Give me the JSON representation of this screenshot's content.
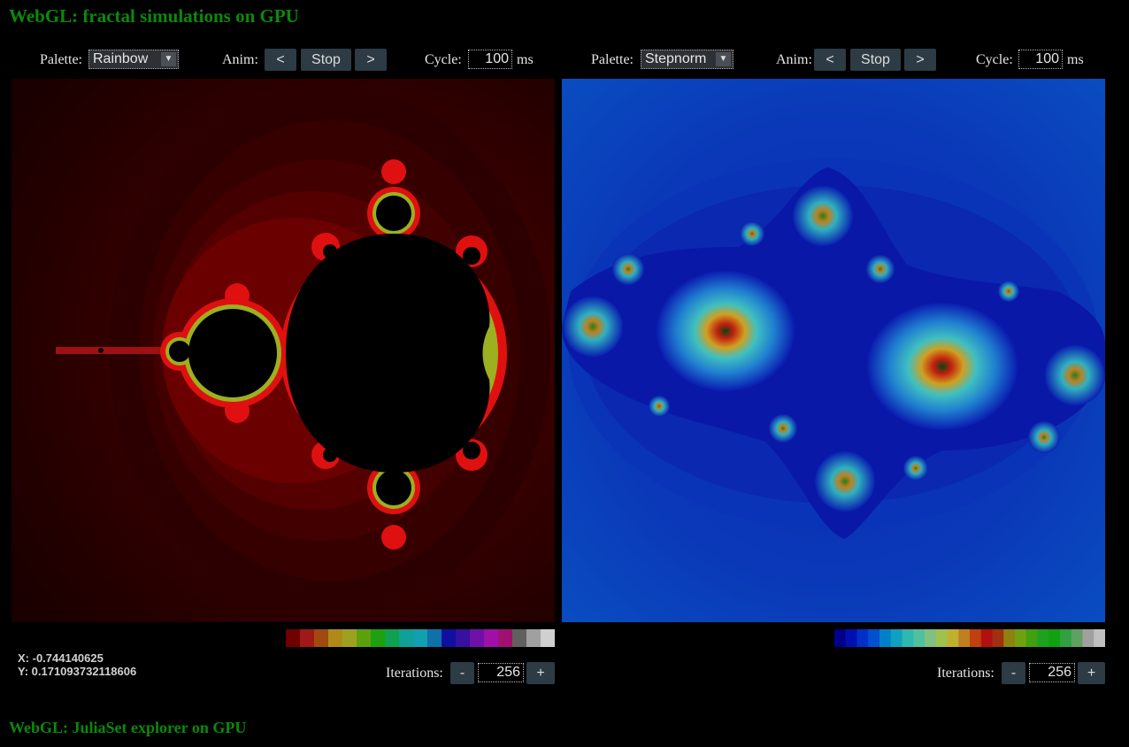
{
  "page_title": "WebGL: fractal simulations on GPU",
  "footer_title": "WebGL: JuliaSet explorer on GPU",
  "left": {
    "palette_label": "Palette:",
    "palette_value": "Rainbow",
    "anim_label": "Anim:",
    "prev_label": "<",
    "stop_label": "Stop",
    "next_label": ">",
    "cycle_label": "Cycle:",
    "cycle_value": "100",
    "cycle_unit": "ms",
    "coord_x": "X: -0.744140625",
    "coord_y": "Y: 0.171093732118606",
    "iterations_label": "Iterations:",
    "iter_minus": "-",
    "iterations_value": "256",
    "iter_plus": "+",
    "palette_colors": [
      "#6e0000",
      "#a01818",
      "#a04a10",
      "#b08a18",
      "#a0a020",
      "#5ca010",
      "#1ea010",
      "#10a050",
      "#10a098",
      "#10a0b0",
      "#1070a8",
      "#1010a0",
      "#3810a0",
      "#7010a8",
      "#a010a8",
      "#a01070",
      "#606060",
      "#a0a0a0",
      "#d0d0d0"
    ]
  },
  "right": {
    "palette_label": "Palette:",
    "palette_value": "Stepnorm",
    "anim_label": "Anim:",
    "prev_label": "<",
    "stop_label": "Stop",
    "next_label": ">",
    "cycle_label": "Cycle:",
    "cycle_value": "100",
    "cycle_unit": "ms",
    "iterations_label": "Iterations:",
    "iter_minus": "-",
    "iterations_value": "256",
    "iter_plus": "+",
    "palette_colors": [
      "#00008a",
      "#0010b0",
      "#0030c8",
      "#0050d0",
      "#0080c8",
      "#10a0c0",
      "#30b8b0",
      "#50c0a0",
      "#80c080",
      "#a0c050",
      "#c0b030",
      "#c08020",
      "#c04010",
      "#b01010",
      "#a03010",
      "#908010",
      "#70a010",
      "#40a010",
      "#20a020",
      "#10a010",
      "#30a040",
      "#60a060",
      "#a0a0a0",
      "#c0c0c0"
    ]
  }
}
